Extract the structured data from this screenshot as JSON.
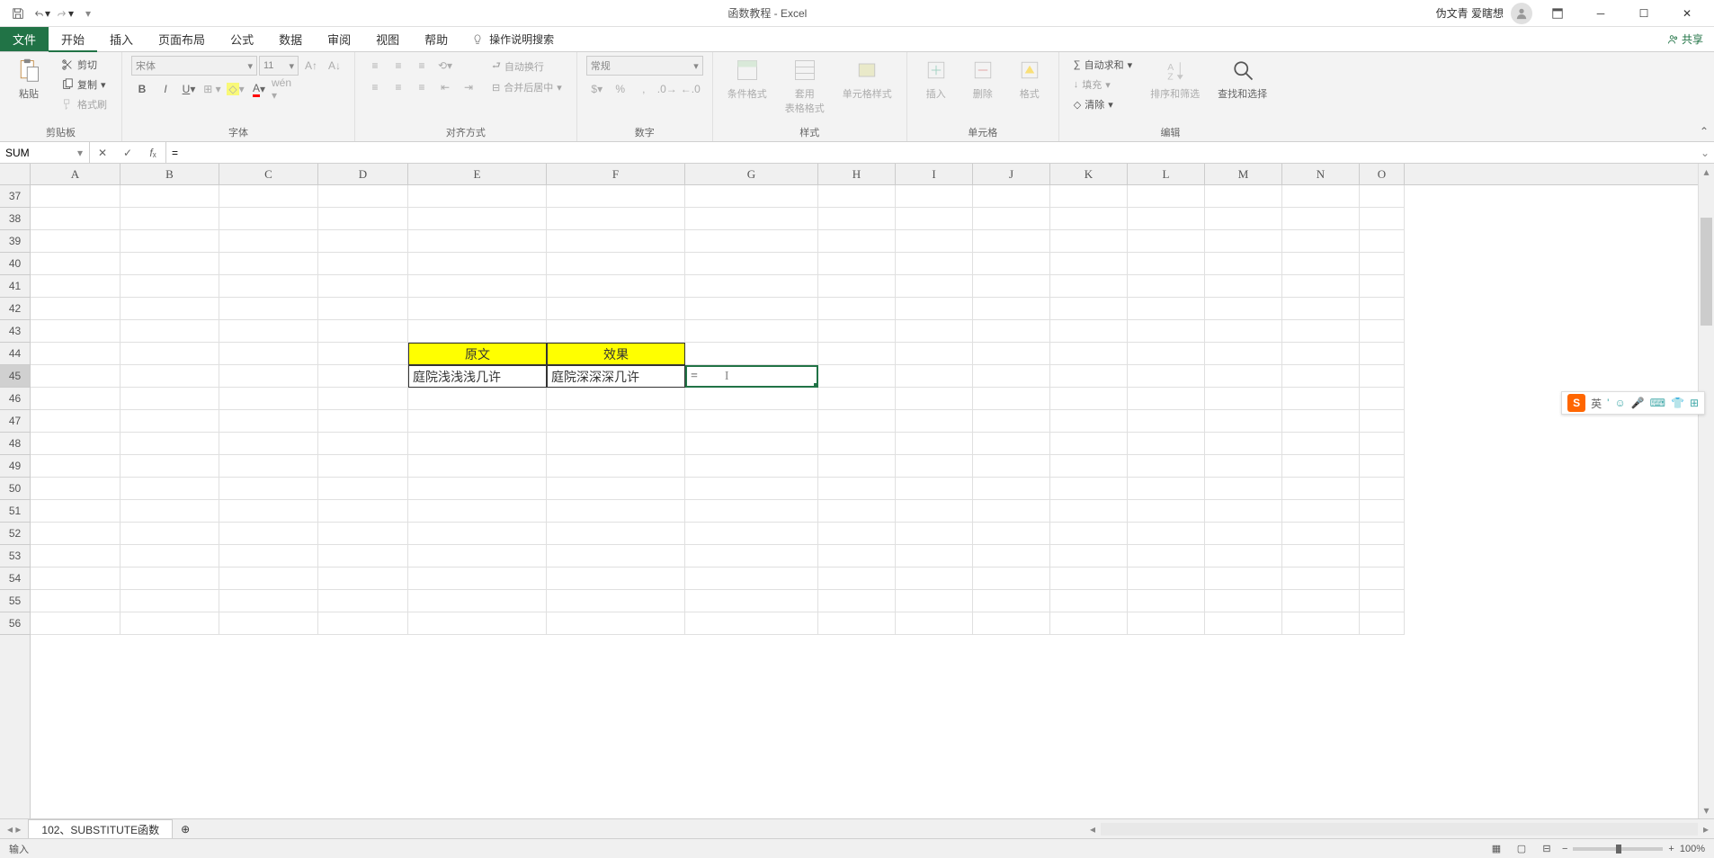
{
  "title": "函数教程 - Excel",
  "user": "伪文青 爱瞎想",
  "tabs": {
    "file": "文件",
    "home": "开始",
    "insert": "插入",
    "layout": "页面布局",
    "formulas": "公式",
    "data": "数据",
    "review": "审阅",
    "view": "视图",
    "help": "帮助",
    "tellme": "操作说明搜索"
  },
  "share": "共享",
  "ribbon": {
    "clipboard": {
      "label": "剪贴板",
      "paste": "粘贴",
      "cut": "剪切",
      "copy": "复制",
      "painter": "格式刷"
    },
    "font": {
      "label": "字体",
      "name": "宋体",
      "size": "11"
    },
    "alignment": {
      "label": "对齐方式",
      "wrap": "自动换行",
      "merge": "合并后居中"
    },
    "number": {
      "label": "数字",
      "format": "常规"
    },
    "styles": {
      "label": "样式",
      "cond": "条件格式",
      "table": "套用\n表格格式",
      "cell": "单元格样式"
    },
    "cells": {
      "label": "单元格",
      "insert": "插入",
      "delete": "删除",
      "format": "格式"
    },
    "editing": {
      "label": "编辑",
      "sum": "自动求和",
      "fill": "填充",
      "clear": "清除",
      "sort": "排序和筛选",
      "find": "查找和选择"
    }
  },
  "name_box": "SUM",
  "formula": "=",
  "columns": [
    "A",
    "B",
    "C",
    "D",
    "E",
    "F",
    "G",
    "H",
    "I",
    "J",
    "K",
    "L",
    "M",
    "N",
    "O"
  ],
  "rows_start": 37,
  "rows_end": 56,
  "table": {
    "h1": "原文",
    "h2": "效果",
    "v1": "庭院浅浅浅几许",
    "v2": "庭院深深深几许"
  },
  "active_cell_value": "=",
  "sheet_tab": "102、SUBSTITUTE函数",
  "status": "输入",
  "zoom": "100%",
  "ime_lang": "英"
}
